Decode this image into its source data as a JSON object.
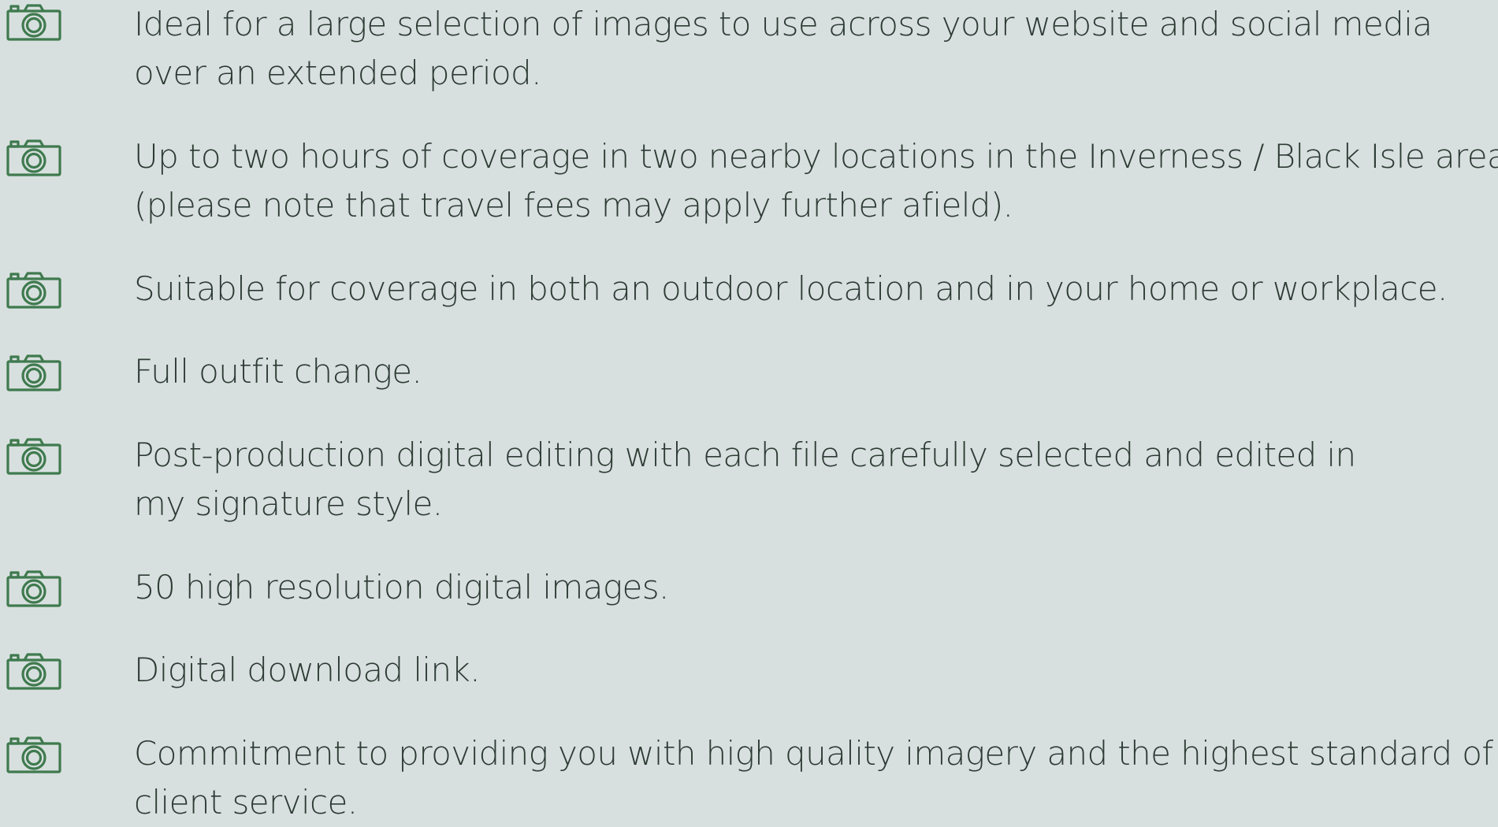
{
  "features": [
    {
      "icon": "camera-icon",
      "lines": [
        "Ideal for a large selection of images to use across your website and social media",
        "over an extended period."
      ]
    },
    {
      "icon": "camera-icon",
      "lines": [
        "Up to two hours of coverage in two nearby locations in the Inverness / Black Isle area",
        "(please note that travel fees may apply further afield)."
      ]
    },
    {
      "icon": "camera-icon",
      "lines": [
        "Suitable for coverage in both an outdoor location and in your home or workplace."
      ]
    },
    {
      "icon": "camera-icon",
      "lines": [
        "Full outfit change."
      ]
    },
    {
      "icon": "camera-icon",
      "lines": [
        "Post-production digital editing with each file carefully selected and edited in",
        "my signature style."
      ]
    },
    {
      "icon": "camera-icon",
      "lines": [
        "50 high resolution digital images."
      ]
    },
    {
      "icon": "camera-icon",
      "lines": [
        "Digital download link."
      ]
    },
    {
      "icon": "camera-icon",
      "lines": [
        "Commitment to providing you with high quality imagery and the highest standard of",
        "client service."
      ]
    }
  ],
  "colors": {
    "background": "#d8e0df",
    "icon": "#3f7a4e",
    "text": "#2d3b34"
  }
}
